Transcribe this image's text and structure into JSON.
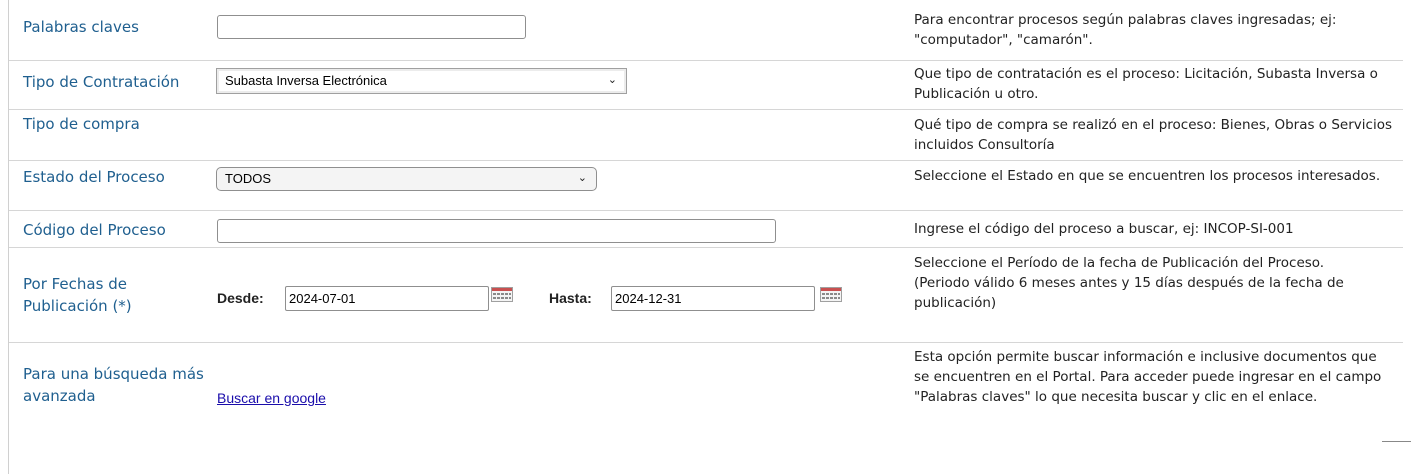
{
  "rows": {
    "palabras": {
      "label": "Palabras claves",
      "input_value": "",
      "help": "Para encontrar procesos según palabras claves ingresadas; ej: \"computador\", \"camarón\"."
    },
    "tipo_contratacion": {
      "label": "Tipo de Contratación",
      "selected": "Subasta Inversa Electrónica",
      "help": "Que tipo de contratación es el proceso: Licitación, Subasta Inversa o Publicación u otro."
    },
    "tipo_compra": {
      "label": "Tipo de compra",
      "help": "Qué tipo de compra se realizó en el proceso: Bienes, Obras o Servicios incluidos Consultoría"
    },
    "estado": {
      "label": "Estado del Proceso",
      "selected": "TODOS",
      "help": "Seleccione el Estado en que se encuentren los procesos interesados."
    },
    "codigo": {
      "label": "Código del Proceso",
      "input_value": "",
      "help": "Ingrese el código del proceso a buscar, ej: INCOP-SI-001"
    },
    "fechas": {
      "label": "Por Fechas de Publicación (*)",
      "desde_label": "Desde:",
      "desde_value": "2024-07-01",
      "hasta_label": "Hasta:",
      "hasta_value": "2024-12-31",
      "help": "Seleccione el Período de la fecha de Publicación del Proceso.",
      "help_note": "(Periodo válido 6 meses antes y 15 días después de la fecha de publicación)"
    },
    "avanzada": {
      "label": "Para una búsqueda más avanzada",
      "link": "Buscar en google",
      "help": "Esta opción permite buscar información e inclusive documentos que se encuentren en el Portal. Para acceder puede ingresar en el campo \"Palabras claves\" lo que necesita buscar y clic en el enlace."
    }
  },
  "icons": {
    "calendar": "calendar-icon",
    "dropdown": "chevron-down-icon"
  },
  "colors": {
    "label": "#1f5f8f",
    "link": "#1a0dab",
    "divider": "#d6d6d6"
  }
}
